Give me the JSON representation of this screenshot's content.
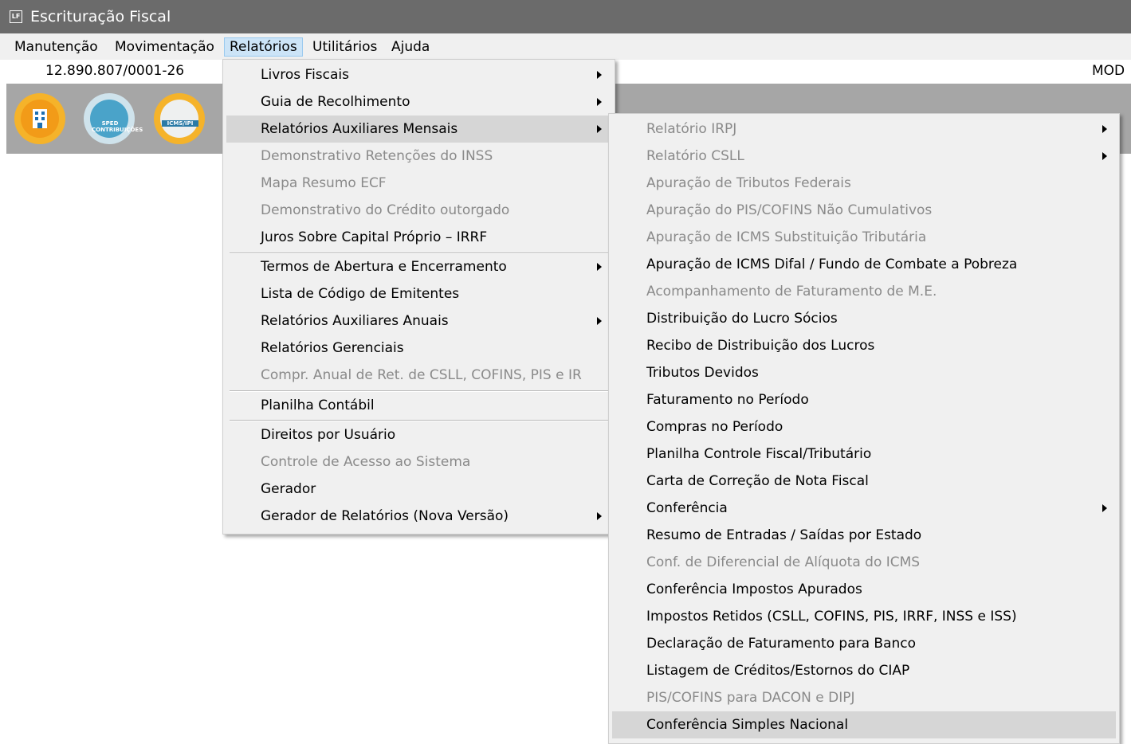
{
  "window": {
    "title": "Escrituração Fiscal",
    "icon_text": "LF"
  },
  "menubar": [
    {
      "label": "Manutenção"
    },
    {
      "label": "Movimentação"
    },
    {
      "label": "Relatórios"
    },
    {
      "label": "Utilitários"
    },
    {
      "label": "Ajuda"
    }
  ],
  "infobar": {
    "cnpj": "12.890.807/0001-26",
    "mod": "MOD"
  },
  "toolbar": [
    {
      "name": "company-icon",
      "label": ""
    },
    {
      "name": "sped-contribuicoes-icon",
      "label": "SPED CONTRIBUIÇÕES"
    },
    {
      "name": "icms-ipi-icon",
      "label": "ICMS/IPI"
    }
  ],
  "relatorios_menu": [
    {
      "label": "Livros Fiscais",
      "submenu": true,
      "disabled": false
    },
    {
      "label": "Guia de Recolhimento",
      "submenu": true,
      "disabled": false
    },
    {
      "label": "Relatórios Auxiliares Mensais",
      "submenu": true,
      "disabled": false,
      "highlight": true
    },
    {
      "label": "Demonstrativo Retenções do INSS",
      "submenu": false,
      "disabled": true
    },
    {
      "label": "Mapa Resumo ECF",
      "submenu": false,
      "disabled": true
    },
    {
      "label": "Demonstrativo do Crédito outorgado",
      "submenu": false,
      "disabled": true
    },
    {
      "label": "Juros Sobre Capital Próprio – IRRF",
      "submenu": false,
      "disabled": false
    },
    {
      "label": "Termos de Abertura e Encerramento",
      "submenu": true,
      "disabled": false
    },
    {
      "label": "Lista de Código de Emitentes",
      "submenu": false,
      "disabled": false
    },
    {
      "label": "Relatórios Auxiliares Anuais",
      "submenu": true,
      "disabled": false
    },
    {
      "label": "Relatórios Gerenciais",
      "submenu": false,
      "disabled": false
    },
    {
      "label": "Compr. Anual de Ret. de CSLL, COFINS,  PIS e IR",
      "submenu": false,
      "disabled": true
    },
    {
      "label": "Planilha Contábil",
      "submenu": false,
      "disabled": false
    },
    {
      "label": "Direitos por Usuário",
      "submenu": false,
      "disabled": false
    },
    {
      "label": "Controle de Acesso ao Sistema",
      "submenu": false,
      "disabled": true
    },
    {
      "label": "Gerador",
      "submenu": false,
      "disabled": false
    },
    {
      "label": "Gerador de Relatórios (Nova Versão)",
      "submenu": true,
      "disabled": false
    }
  ],
  "mensais_menu": [
    {
      "label": "Relatório IRPJ",
      "submenu": true,
      "disabled": true
    },
    {
      "label": "Relatório CSLL",
      "submenu": true,
      "disabled": true
    },
    {
      "label": "Apuração de Tributos Federais",
      "submenu": false,
      "disabled": true
    },
    {
      "label": "Apuração do PIS/COFINS Não Cumulativos",
      "submenu": false,
      "disabled": true
    },
    {
      "label": "Apuração de ICMS Substituição Tributária",
      "submenu": false,
      "disabled": true
    },
    {
      "label": "Apuração de ICMS Difal / Fundo de Combate a Pobreza",
      "submenu": false,
      "disabled": false
    },
    {
      "label": "Acompanhamento de Faturamento de M.E.",
      "submenu": false,
      "disabled": true
    },
    {
      "label": "Distribuição do Lucro Sócios",
      "submenu": false,
      "disabled": false
    },
    {
      "label": "Recibo de Distribuição dos Lucros",
      "submenu": false,
      "disabled": false
    },
    {
      "label": "Tributos Devidos",
      "submenu": false,
      "disabled": false
    },
    {
      "label": "Faturamento no Período",
      "submenu": false,
      "disabled": false
    },
    {
      "label": "Compras no Período",
      "submenu": false,
      "disabled": false
    },
    {
      "label": "Planilha Controle Fiscal/Tributário",
      "submenu": false,
      "disabled": false
    },
    {
      "label": "Carta de Correção de Nota Fiscal",
      "submenu": false,
      "disabled": false
    },
    {
      "label": "Conferência",
      "submenu": true,
      "disabled": false
    },
    {
      "label": "Resumo de Entradas / Saídas por Estado",
      "submenu": false,
      "disabled": false
    },
    {
      "label": "Conf. de Diferencial de Alíquota do ICMS",
      "submenu": false,
      "disabled": true
    },
    {
      "label": "Conferência Impostos Apurados",
      "submenu": false,
      "disabled": false
    },
    {
      "label": "Impostos Retidos (CSLL, COFINS,  PIS, IRRF, INSS e ISS)",
      "submenu": false,
      "disabled": false
    },
    {
      "label": "Declaração de Faturamento para Banco",
      "submenu": false,
      "disabled": false
    },
    {
      "label": "Listagem de Créditos/Estornos do CIAP",
      "submenu": false,
      "disabled": false
    },
    {
      "label": "PIS/COFINS para DACON e DIPJ",
      "submenu": false,
      "disabled": true
    },
    {
      "label": "Conferência Simples Nacional",
      "submenu": false,
      "disabled": false,
      "highlight": true
    }
  ]
}
